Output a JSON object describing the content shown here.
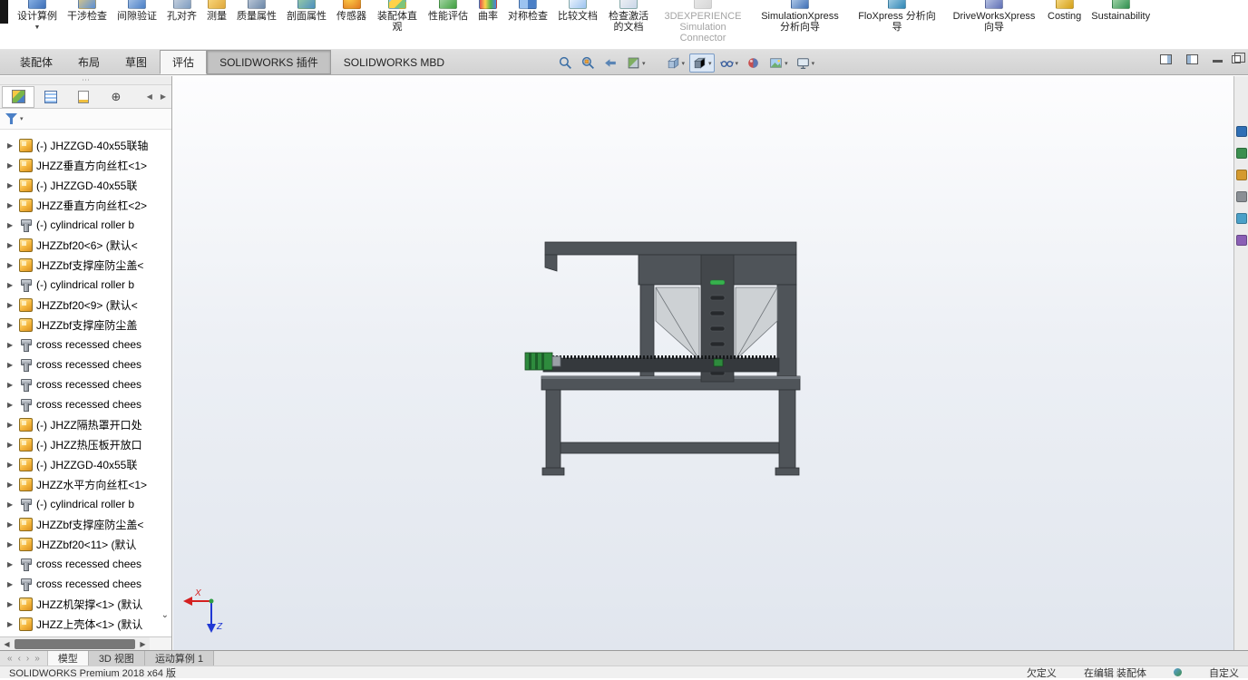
{
  "glyphs": {
    "caret_down": "▼",
    "caret_small": "▾",
    "expand_arrow": "▶",
    "arrow_left": "◀",
    "arrow_right": "▶",
    "chevron_down": "⌄",
    "nav_first": "«",
    "nav_prev": "‹",
    "nav_next": "›",
    "nav_last": "»",
    "dots": "⋯",
    "target": "⊕"
  },
  "ribbon": {
    "items": [
      {
        "label": "设计算例",
        "icon": "ri-study",
        "dropdown": true
      },
      {
        "label": "干涉检查",
        "icon": "ri-interference"
      },
      {
        "label": "间隙验证",
        "icon": "ri-clearance"
      },
      {
        "label": "孔对齐",
        "icon": "ri-hole"
      },
      {
        "label": "测量",
        "icon": "ri-measure"
      },
      {
        "label": "质量属性",
        "icon": "ri-mass"
      },
      {
        "label": "剖面属性",
        "icon": "ri-sectionprop"
      },
      {
        "label": "传感器",
        "icon": "ri-sensor"
      },
      {
        "label": "装配体直观",
        "icon": "ri-visual"
      },
      {
        "label": "性能评估",
        "icon": "ri-perf"
      },
      {
        "label": "曲率",
        "icon": "ri-curvature"
      },
      {
        "label": "对称检查",
        "icon": "ri-symmetry"
      },
      {
        "label": "比较文档",
        "icon": "ri-compare"
      },
      {
        "label": "检查激活的文档",
        "icon": "ri-checkdoc"
      },
      {
        "label": "3DEXPERIENCE Simulation Connector",
        "icon": "ri-gray",
        "wide": true,
        "disabled": true
      },
      {
        "label": "SimulationXpress 分析向导",
        "icon": "ri-simx",
        "wide": true
      },
      {
        "label": "FloXpress 分析向导",
        "icon": "ri-flox",
        "wide": true
      },
      {
        "label": "DriveWorksXpress 向导",
        "icon": "ri-dwx",
        "wide": true
      },
      {
        "label": "Costing",
        "icon": "ri-costing",
        "wide": true
      },
      {
        "label": "Sustainability",
        "icon": "ri-sustain",
        "wide": true
      }
    ]
  },
  "command_tabs": [
    {
      "label": "装配体"
    },
    {
      "label": "布局"
    },
    {
      "label": "草图"
    },
    {
      "label": "评估",
      "active": true
    },
    {
      "label": "SOLIDWORKS 插件",
      "pressed": true
    },
    {
      "label": "SOLIDWORKS MBD"
    }
  ],
  "headsup": {
    "icons": [
      "zoom-fit",
      "zoom-to-area",
      "previous-view",
      "section-view",
      "view-orientation",
      "display-style",
      "hide-show-items",
      "edit-appearance",
      "apply-scene",
      "view-settings"
    ]
  },
  "tree": {
    "items": [
      {
        "label": "(-) JHZZGD-40x55联轴",
        "icon": "assembly"
      },
      {
        "label": "JHZZ垂直方向丝杠<1>",
        "icon": "assembly"
      },
      {
        "label": "(-) JHZZGD-40x55联",
        "icon": "assembly"
      },
      {
        "label": "JHZZ垂直方向丝杠<2>",
        "icon": "assembly"
      },
      {
        "label": "(-) cylindrical roller b",
        "icon": "bolt"
      },
      {
        "label": "JHZZbf20<6> (默认<",
        "icon": "assembly"
      },
      {
        "label": "JHZZbf支撑座防尘盖<",
        "icon": "assembly"
      },
      {
        "label": "(-) cylindrical roller b",
        "icon": "bolt"
      },
      {
        "label": "JHZZbf20<9> (默认<",
        "icon": "assembly"
      },
      {
        "label": "JHZZbf支撑座防尘盖",
        "icon": "assembly"
      },
      {
        "label": "cross recessed chees",
        "icon": "bolt"
      },
      {
        "label": "cross recessed chees",
        "icon": "bolt"
      },
      {
        "label": "cross recessed chees",
        "icon": "bolt"
      },
      {
        "label": "cross recessed chees",
        "icon": "bolt"
      },
      {
        "label": "(-) JHZZ隔热罩开口处",
        "icon": "assembly"
      },
      {
        "label": "(-) JHZZ热压板开放口",
        "icon": "assembly"
      },
      {
        "label": "(-) JHZZGD-40x55联",
        "icon": "assembly"
      },
      {
        "label": "JHZZ水平方向丝杠<1>",
        "icon": "assembly"
      },
      {
        "label": "(-) cylindrical roller b",
        "icon": "bolt"
      },
      {
        "label": "JHZZbf支撑座防尘盖<",
        "icon": "assembly"
      },
      {
        "label": "JHZZbf20<11> (默认",
        "icon": "assembly"
      },
      {
        "label": "cross recessed chees",
        "icon": "bolt"
      },
      {
        "label": "cross recessed chees",
        "icon": "bolt"
      },
      {
        "label": "JHZZ机架撑<1> (默认",
        "icon": "assembly"
      },
      {
        "label": "JHZZ上壳体<1> (默认",
        "icon": "assembly"
      }
    ]
  },
  "viewport": {
    "triad": {
      "x": "X",
      "z": "Z"
    },
    "model": {
      "body_color": "#4f5459",
      "panel_color": "#cdd1d4",
      "accent_color": "#2e8b3d"
    }
  },
  "sheet_tabs": [
    {
      "label": "模型",
      "active": true
    },
    {
      "label": "3D 视图"
    },
    {
      "label": "运动算例 1"
    }
  ],
  "status_bar": {
    "left": "SOLIDWORKS Premium 2018 x64 版",
    "doc_state": "欠定义",
    "edit_state": "在编辑 装配体",
    "customize": "自定义"
  }
}
